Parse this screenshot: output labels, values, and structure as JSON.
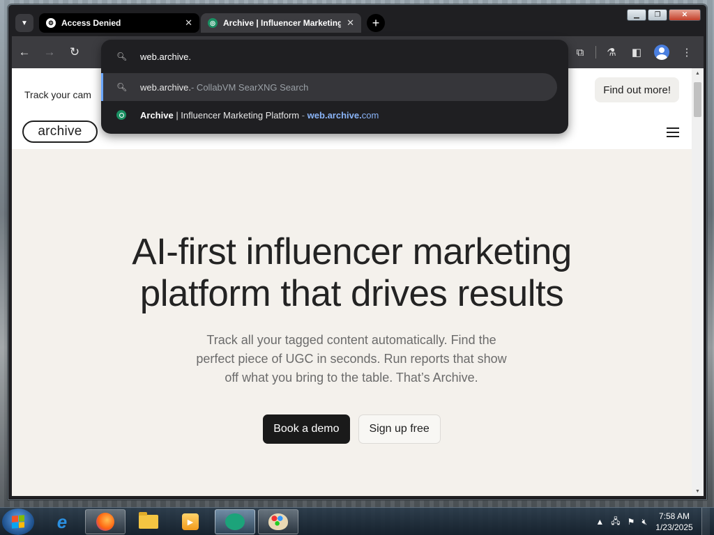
{
  "browser": {
    "tabs": [
      {
        "title": "Access Denied",
        "active": false
      },
      {
        "title": "Archive | Influencer Marketing Platform",
        "active": true
      }
    ],
    "tab_close_glyph": "✕",
    "new_tab_glyph": "+",
    "omnibox": {
      "query": "web.archive.",
      "suggestions": [
        {
          "text": "web.archive.",
          "suffix": " - CollabVM SearXNG Search",
          "icon": "search-icon"
        },
        {
          "title_bold": "Archive",
          "title_rest": " | Influencer Marketing Platform",
          "separator": " - ",
          "url_bold": "web.archive.",
          "url_rest": "com",
          "icon": "site-favicon"
        }
      ]
    }
  },
  "page": {
    "banner_text": "Track your cam",
    "banner_button": "Find out more!",
    "logo": "archive",
    "hero_title_line1": "AI-first influencer marketing",
    "hero_title_line2": "platform that drives results",
    "hero_subtitle": "Track all your tagged content automatically. Find the perfect piece of UGC in seconds. Run reports that show off what you bring to the table. That’s Archive.",
    "primary_cta": "Book a demo",
    "secondary_cta": "Sign up free"
  },
  "taskbar": {
    "clock_time": "7:58 AM",
    "clock_date": "1/23/2025"
  },
  "colors": {
    "page_background": "#f4f1ec",
    "primary_button": "#1a1a1a",
    "browser_chrome": "#3c3c40",
    "link_accent": "#8ab4f8"
  }
}
